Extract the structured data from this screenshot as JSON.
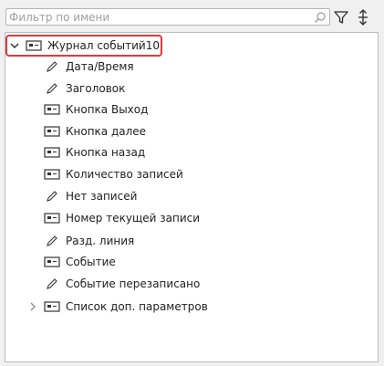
{
  "search": {
    "placeholder": "Фильтр по имени",
    "value": ""
  },
  "toolbar": {
    "filter_icon": "filter-icon",
    "sort_icon": "sort-icon"
  },
  "tree": {
    "root": {
      "label": "Журнал событий10",
      "icon": "component-icon",
      "expanded": true,
      "highlighted": true
    },
    "children": [
      {
        "label": "Дата/Время",
        "icon": "pencil-icon"
      },
      {
        "label": "Заголовок",
        "icon": "pencil-icon"
      },
      {
        "label": "Кнопка Выход",
        "icon": "component-icon"
      },
      {
        "label": "Кнопка далее",
        "icon": "component-icon"
      },
      {
        "label": "Кнопка назад",
        "icon": "component-icon"
      },
      {
        "label": "Количество записей",
        "icon": "component-icon"
      },
      {
        "label": "Нет записей",
        "icon": "pencil-icon"
      },
      {
        "label": "Номер текущей записи",
        "icon": "component-icon"
      },
      {
        "label": "Разд. линия",
        "icon": "pencil-icon"
      },
      {
        "label": "Событие",
        "icon": "component-icon"
      },
      {
        "label": "Событие перезаписано",
        "icon": "pencil-icon"
      },
      {
        "label": "Список доп. параметров",
        "icon": "component-icon",
        "expandable": true
      }
    ]
  },
  "colors": {
    "highlight": "#e0393e",
    "panel_bg": "#f0f0f0",
    "tree_bg": "#ffffff"
  }
}
